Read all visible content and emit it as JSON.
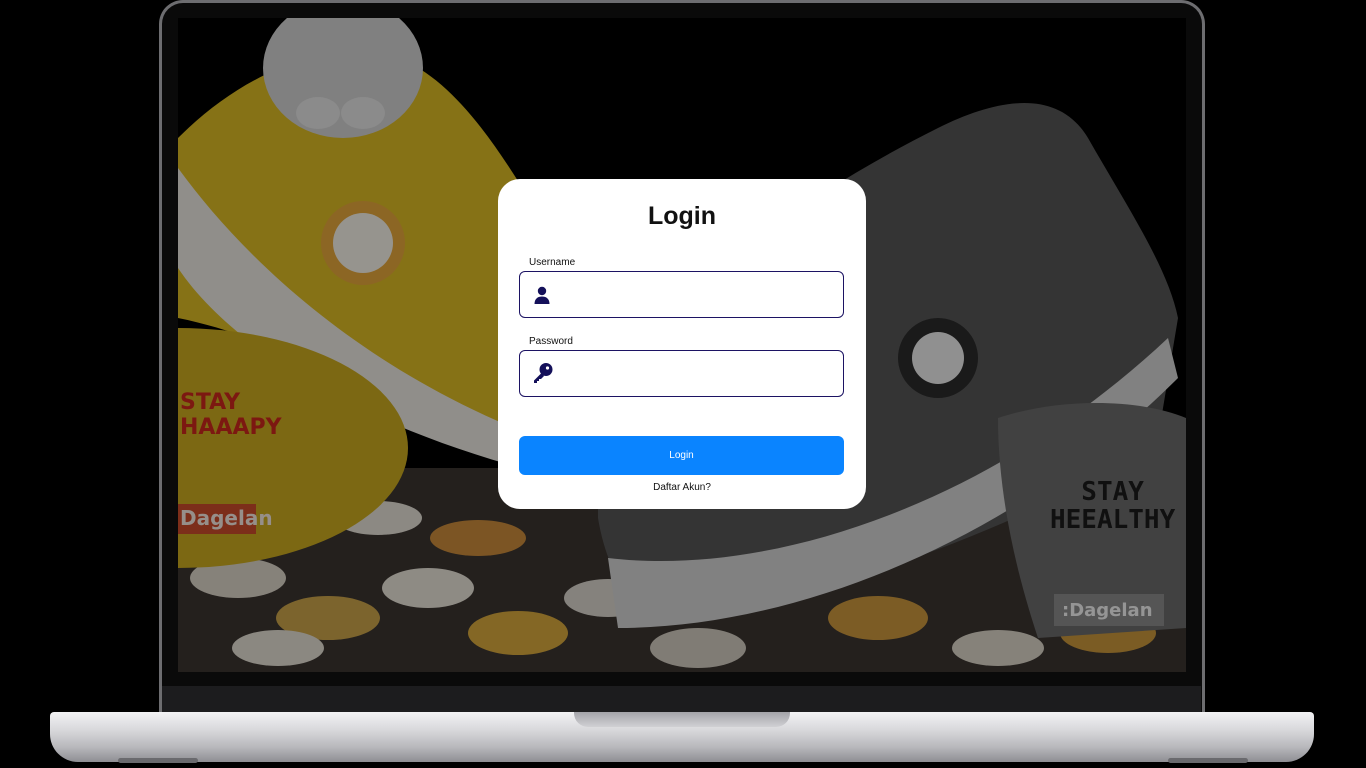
{
  "login": {
    "title": "Login",
    "username_label": "Username",
    "username_value": "",
    "password_label": "Password",
    "password_value": "",
    "submit_label": "Login",
    "register_link": "Daftar Akun?"
  },
  "background": {
    "shoe_left_text": [
      "STAY",
      "HAAAPY"
    ],
    "shoe_left_brand": "Dagelan",
    "shoe_right_text": [
      "STAY",
      "HEEALTHY"
    ],
    "shoe_right_brand": ":Dagelan"
  },
  "icons": {
    "username": "user-icon",
    "password": "key-icon"
  },
  "colors": {
    "primary_button": "#0a84ff",
    "input_border": "#1c1363",
    "icon": "#14105a"
  }
}
